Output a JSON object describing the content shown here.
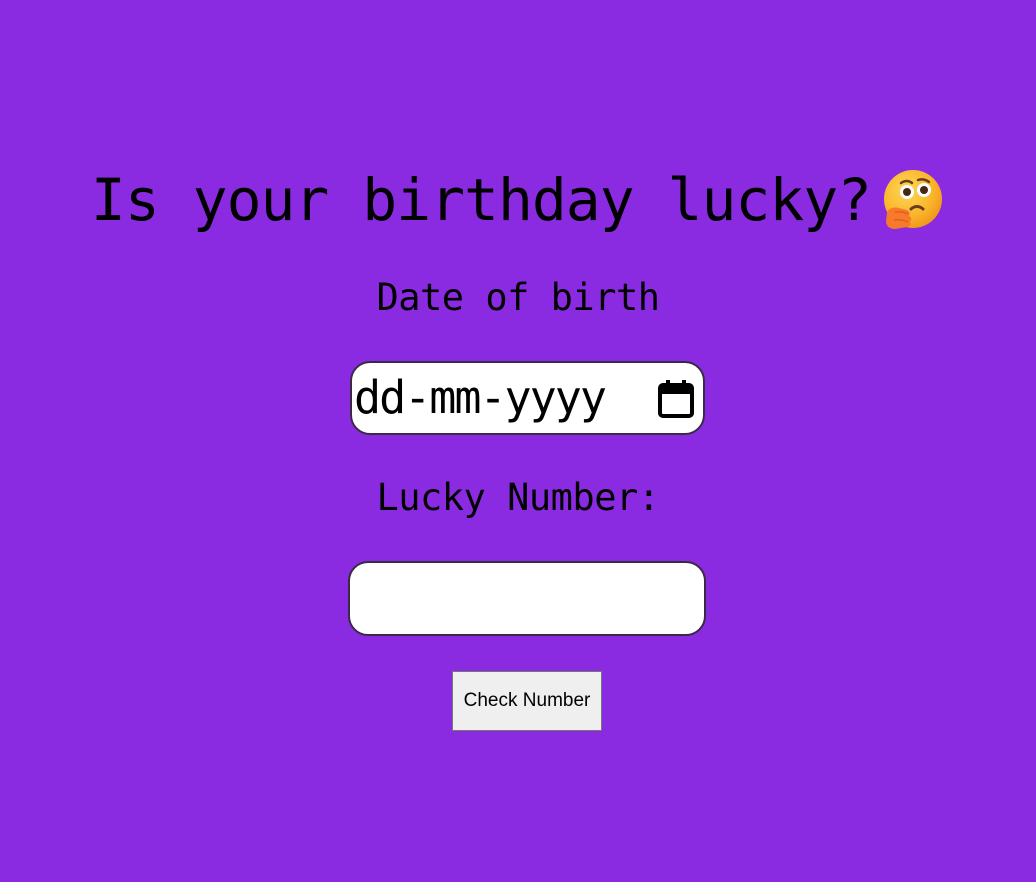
{
  "header": {
    "title": "Is your birthday lucky?",
    "title_emoji": "thinking-face-icon"
  },
  "form": {
    "dob_label": "Date of birth",
    "dob_placeholder": "dd-mm-yyyy",
    "dob_icon": "calendar-icon",
    "lucky_label": "Lucky Number:",
    "lucky_value": "",
    "check_button_label": "Check Number"
  },
  "colors": {
    "background": "#8a2be2",
    "button_bg": "#efefef",
    "input_bg": "#ffffff"
  }
}
